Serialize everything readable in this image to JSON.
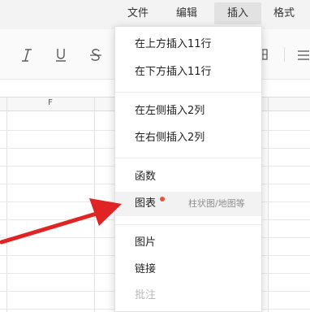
{
  "menubar": {
    "items": [
      {
        "label": "文件"
      },
      {
        "label": "编辑"
      },
      {
        "label": "插入"
      },
      {
        "label": "格式"
      }
    ]
  },
  "toolbar": {
    "icons": [
      "italic-icon",
      "underline-icon",
      "strikethrough-icon",
      "border-icon",
      "align-icon"
    ]
  },
  "grid": {
    "visible_column": "F"
  },
  "insert_menu": {
    "items": [
      {
        "label": "在上方插入11行"
      },
      {
        "label": "在下方插入11行"
      },
      {
        "label": "在左侧插入2列"
      },
      {
        "label": "在右侧插入2列"
      },
      {
        "label": "函数"
      },
      {
        "label": "图表",
        "hint": "柱状图/地图等",
        "badge_color": "#e8523a"
      },
      {
        "label": "图片"
      },
      {
        "label": "链接"
      },
      {
        "label": "批注",
        "disabled": true
      }
    ]
  },
  "annotation": {
    "arrow_color": "#e02424"
  }
}
